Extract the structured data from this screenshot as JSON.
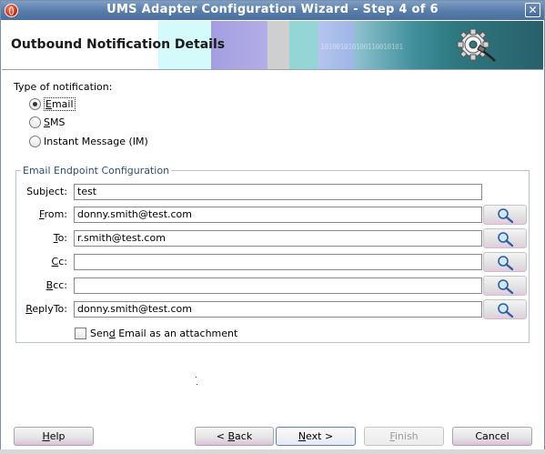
{
  "window": {
    "title": "UMS Adapter Configuration Wizard - Step 4 of 6",
    "close_label": "✕"
  },
  "header": {
    "heading": "Outbound Notification Details",
    "decor_binary": "101001010100110010101"
  },
  "notification_type": {
    "label": "Type of notification:",
    "options": [
      {
        "label": "Email",
        "mnemonic": "E",
        "rest": "mail",
        "selected": true
      },
      {
        "label": "SMS",
        "mnemonic": "S",
        "rest": "MS",
        "selected": false
      },
      {
        "label": "Instant Message (IM)",
        "mnemonic": "",
        "rest": "Instant Message (IM)",
        "selected": false
      }
    ]
  },
  "email_config": {
    "group_title": "Email Endpoint Configuration",
    "fields": {
      "subject": {
        "pre": "Sub",
        "mn": "j",
        "post": "ect:",
        "value": "test"
      },
      "from": {
        "pre": "",
        "mn": "F",
        "post": "rom:",
        "value": "donny.smith@test.com"
      },
      "to": {
        "pre": "",
        "mn": "T",
        "post": "o:",
        "value": "r.smith@test.com"
      },
      "cc": {
        "pre": "",
        "mn": "C",
        "post": "c:",
        "value": ""
      },
      "bcc": {
        "pre": "",
        "mn": "B",
        "post": "cc:",
        "value": ""
      },
      "replyto": {
        "pre": "",
        "mn": "R",
        "post": "eplyTo:",
        "value": "donny.smith@test.com"
      }
    },
    "attachment_checkbox": {
      "pre": "Sen",
      "mn": "d",
      "post": " Email as an attachment",
      "checked": false
    }
  },
  "buttons": {
    "help": {
      "pre": "",
      "mn": "H",
      "post": "elp"
    },
    "back": {
      "pre": "< ",
      "mn": "B",
      "post": "ack"
    },
    "next": {
      "pre": "",
      "mn": "N",
      "post": "ext >"
    },
    "finish": {
      "pre": "",
      "mn": "F",
      "post": "inish"
    },
    "cancel": {
      "pre": "Cancel",
      "mn": "",
      "post": ""
    }
  },
  "icons": {
    "app": "oracle-icon",
    "close": "close-icon",
    "search": "search-icon",
    "gear": "gear-plug-icon"
  }
}
